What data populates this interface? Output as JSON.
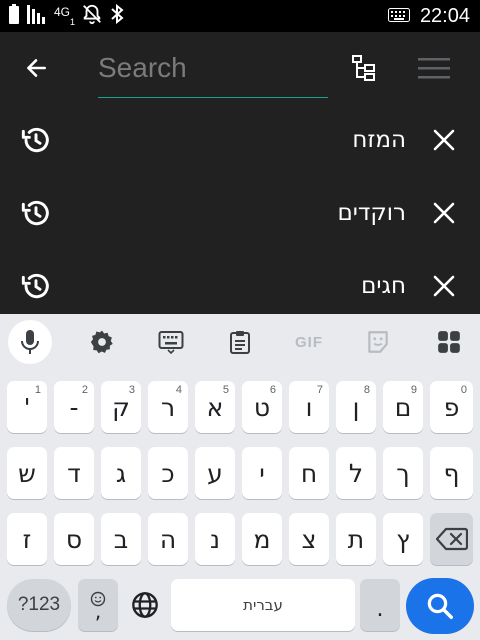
{
  "status_bar": {
    "network": "4G",
    "sim_slot": "1",
    "time": "22:04"
  },
  "search": {
    "placeholder": "Search",
    "value": ""
  },
  "history": [
    {
      "text": "המזח"
    },
    {
      "text": "רוקדים"
    },
    {
      "text": "חגים"
    }
  ],
  "keyboard": {
    "toolbar": [
      "mic-icon",
      "settings-icon",
      "keyboard-icon",
      "clipboard-icon",
      "GIF",
      "sticker-icon",
      "apps-icon"
    ],
    "gif_label": "GIF",
    "rows": [
      [
        {
          "label": "'",
          "hint": "1"
        },
        {
          "label": "-",
          "hint": "2"
        },
        {
          "label": "ק",
          "hint": "3"
        },
        {
          "label": "ר",
          "hint": "4"
        },
        {
          "label": "א",
          "hint": "5"
        },
        {
          "label": "ט",
          "hint": "6"
        },
        {
          "label": "ו",
          "hint": "7"
        },
        {
          "label": "ן",
          "hint": "8"
        },
        {
          "label": "ם",
          "hint": "9"
        },
        {
          "label": "פ",
          "hint": "0"
        }
      ],
      [
        {
          "label": "ש"
        },
        {
          "label": "ד"
        },
        {
          "label": "ג"
        },
        {
          "label": "כ"
        },
        {
          "label": "ע"
        },
        {
          "label": "י"
        },
        {
          "label": "ח"
        },
        {
          "label": "ל"
        },
        {
          "label": "ך"
        },
        {
          "label": "ף"
        }
      ],
      [
        {
          "label": "ז"
        },
        {
          "label": "ס"
        },
        {
          "label": "ב"
        },
        {
          "label": "ה"
        },
        {
          "label": "נ"
        },
        {
          "label": "מ"
        },
        {
          "label": "צ"
        },
        {
          "label": "ת"
        },
        {
          "label": "ץ"
        }
      ]
    ],
    "symbols_label": "?123",
    "emoji_comma": ",",
    "space_label": "עברית",
    "period_label": ".",
    "accent_color": "#1a73e8"
  }
}
